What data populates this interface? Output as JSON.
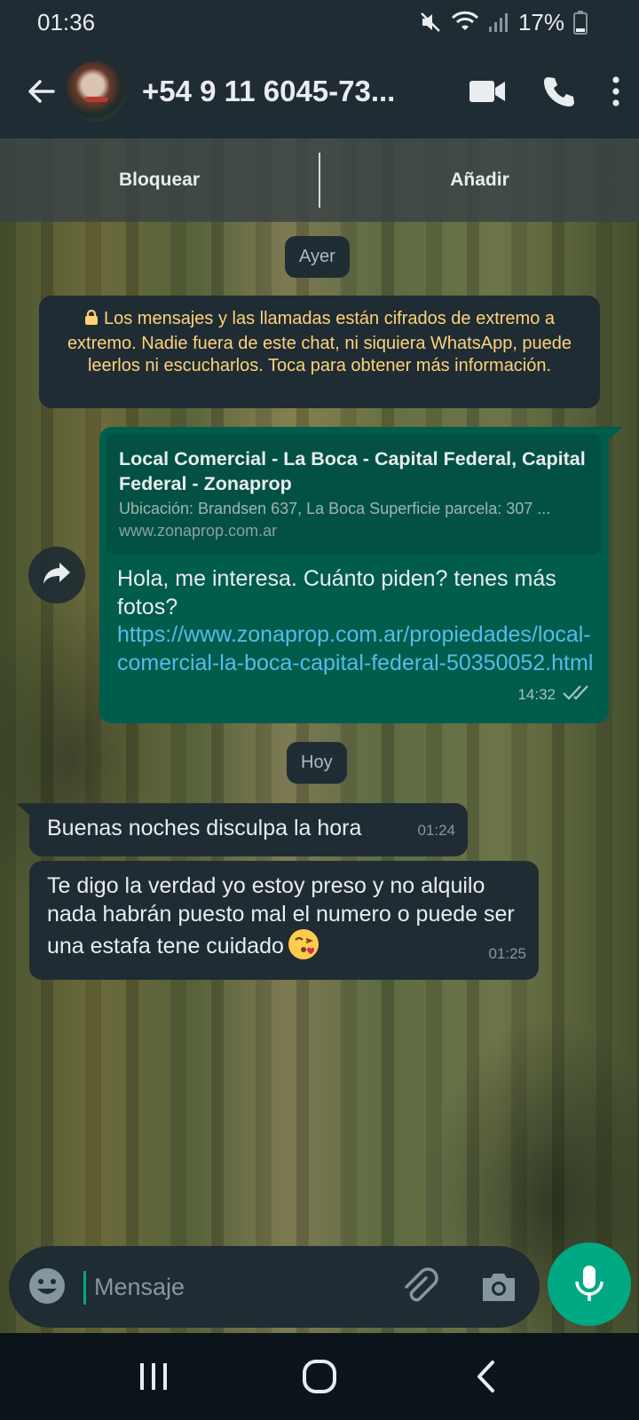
{
  "status_bar": {
    "time": "01:36",
    "battery_percent": "17%",
    "icons": [
      "mute-icon",
      "wifi-icon",
      "signal-icon",
      "battery-icon"
    ]
  },
  "header": {
    "contact": "+54 9 11 6045-73...",
    "icons": [
      "back-arrow-icon",
      "video-call-icon",
      "phone-call-icon",
      "more-options-icon"
    ]
  },
  "action_bar": {
    "block_label": "Bloquear",
    "add_label": "Añadir"
  },
  "chat": {
    "date_yesterday": "Ayer",
    "encryption_notice": "Los mensajes y las llamadas están cifrados de extremo a extremo. Nadie fuera de este chat, ni siquiera WhatsApp, puede leerlos ni escucharlos. Toca para obtener más información.",
    "outgoing": {
      "preview_title": "Local Comercial - La Boca - Capital Federal, Capital Federal - Zonaprop",
      "preview_description": "Ubicación: Brandsen 637, La Boca Superficie parcela: 307 ...",
      "preview_domain": "www.zonaprop.com.ar",
      "text": "Hola, me interesa. Cuánto piden? tenes más fotos?",
      "link": "https://www.zonaprop.com.ar/propiedades/local-comercial-la-boca-capital-federal-50350052.html",
      "time": "14:32",
      "status": "read-double-check"
    },
    "date_today": "Hoy",
    "incoming": [
      {
        "text": "Buenas noches disculpa la hora",
        "time": "01:24"
      },
      {
        "text": "Te digo la verdad yo estoy preso y no alquilo nada habrán puesto mal el numero o puede ser una estafa tene cuidado",
        "emoji": "kissing-face-emoji",
        "time": "01:25"
      }
    ]
  },
  "composer": {
    "placeholder": "Mensaje",
    "icons": [
      "emoji-icon",
      "attach-icon",
      "camera-icon",
      "microphone-icon"
    ]
  },
  "navigation": {
    "icons": [
      "recent-apps-icon",
      "home-icon",
      "back-icon"
    ]
  },
  "colors": {
    "header_bg": "#202c33",
    "outgoing_bubble": "#005c4b",
    "incoming_bubble": "#1f2c33",
    "accent": "#00a884",
    "link": "#53bdeb",
    "notice_text": "#ffd279"
  }
}
